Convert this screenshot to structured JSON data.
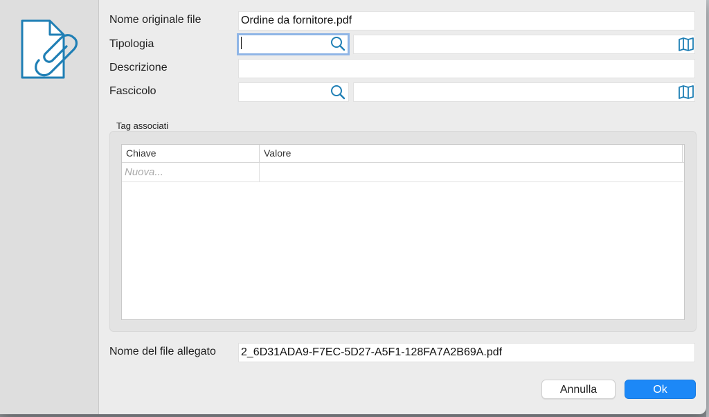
{
  "form": {
    "original_name_label": "Nome originale file",
    "original_name_value": "Ordine da fornitore.pdf",
    "type_label": "Tipologia",
    "type_code_value": "",
    "type_desc_value": "",
    "description_label": "Descrizione",
    "description_value": "",
    "folder_label": "Fascicolo",
    "folder_code_value": "",
    "folder_desc_value": "",
    "attached_name_label": "Nome del file allegato",
    "attached_name_value": "2_6D31ADA9-F7EC-5D27-A5F1-128FA7A2B69A.pdf"
  },
  "tags": {
    "section_label": "Tag associati",
    "columns": [
      "Chiave",
      "Valore"
    ],
    "new_row_placeholder": "Nuova..."
  },
  "buttons": {
    "cancel": "Annulla",
    "ok": "Ok"
  },
  "icons": {
    "sidebar": "document-attachment-icon",
    "search": "magnifier-icon",
    "lookup": "map-icon"
  },
  "colors": {
    "accent": "#1c88f7",
    "icon_blue": "#1f7fb5",
    "focus_ring": "#8fb5e6"
  }
}
